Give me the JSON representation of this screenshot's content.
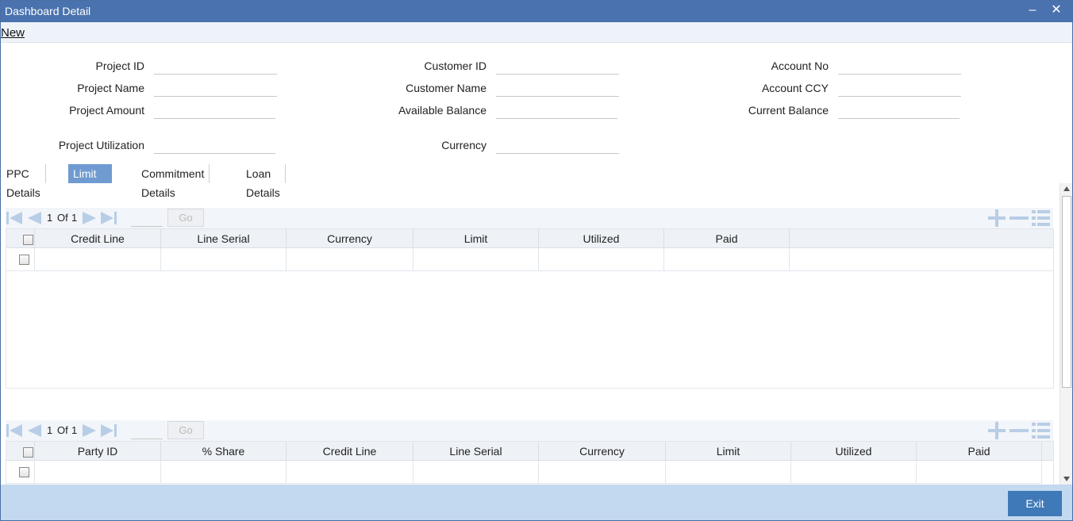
{
  "window": {
    "title": "Dashboard Detail",
    "minimize": "‒",
    "close": "✕"
  },
  "menu": {
    "new_label": "New"
  },
  "fields": {
    "project_id": {
      "label": "Project ID",
      "value": ""
    },
    "project_name": {
      "label": "Project Name",
      "value": ""
    },
    "project_amount": {
      "label": "Project Amount",
      "value": ""
    },
    "project_utilization": {
      "label": "Project Utilization",
      "value": ""
    },
    "customer_id": {
      "label": "Customer ID",
      "value": ""
    },
    "customer_name": {
      "label": "Customer Name",
      "value": ""
    },
    "available_balance": {
      "label": "Available Balance",
      "value": ""
    },
    "currency": {
      "label": "Currency",
      "value": ""
    },
    "account_no": {
      "label": "Account No",
      "value": ""
    },
    "account_ccy": {
      "label": "Account CCY",
      "value": ""
    },
    "current_balance": {
      "label": "Current Balance",
      "value": ""
    }
  },
  "tabs": [
    {
      "label": "PPC Details",
      "active": false
    },
    {
      "label": "Limit Details",
      "active": true
    },
    {
      "label": "Commitment Details",
      "active": false
    },
    {
      "label": "Loan Details",
      "active": false
    }
  ],
  "pager1": {
    "current": "1",
    "of_label": "Of",
    "total": "1",
    "go_label": "Go",
    "page_input": ""
  },
  "grid1": {
    "columns": [
      "Credit Line",
      "Line Serial",
      "Currency",
      "Limit",
      "Utilized",
      "Paid"
    ]
  },
  "pager2": {
    "current": "1",
    "of_label": "Of",
    "total": "1",
    "go_label": "Go",
    "page_input": ""
  },
  "grid2": {
    "columns": [
      "Party ID",
      "% Share",
      "Credit Line",
      "Line Serial",
      "Currency",
      "Limit",
      "Utilized",
      "Paid"
    ]
  },
  "footer": {
    "exit_label": "Exit"
  },
  "colors": {
    "titlebar": "#4a72ae",
    "active_tab": "#6f9bd1",
    "footer": "#c3d9ef",
    "exit_button": "#3f79b7",
    "pager_icon": "#b8cde6"
  },
  "icons": [
    "first-page-icon",
    "previous-page-icon",
    "next-page-icon",
    "last-page-icon",
    "add-row-icon",
    "delete-row-icon",
    "single-record-view-icon"
  ]
}
